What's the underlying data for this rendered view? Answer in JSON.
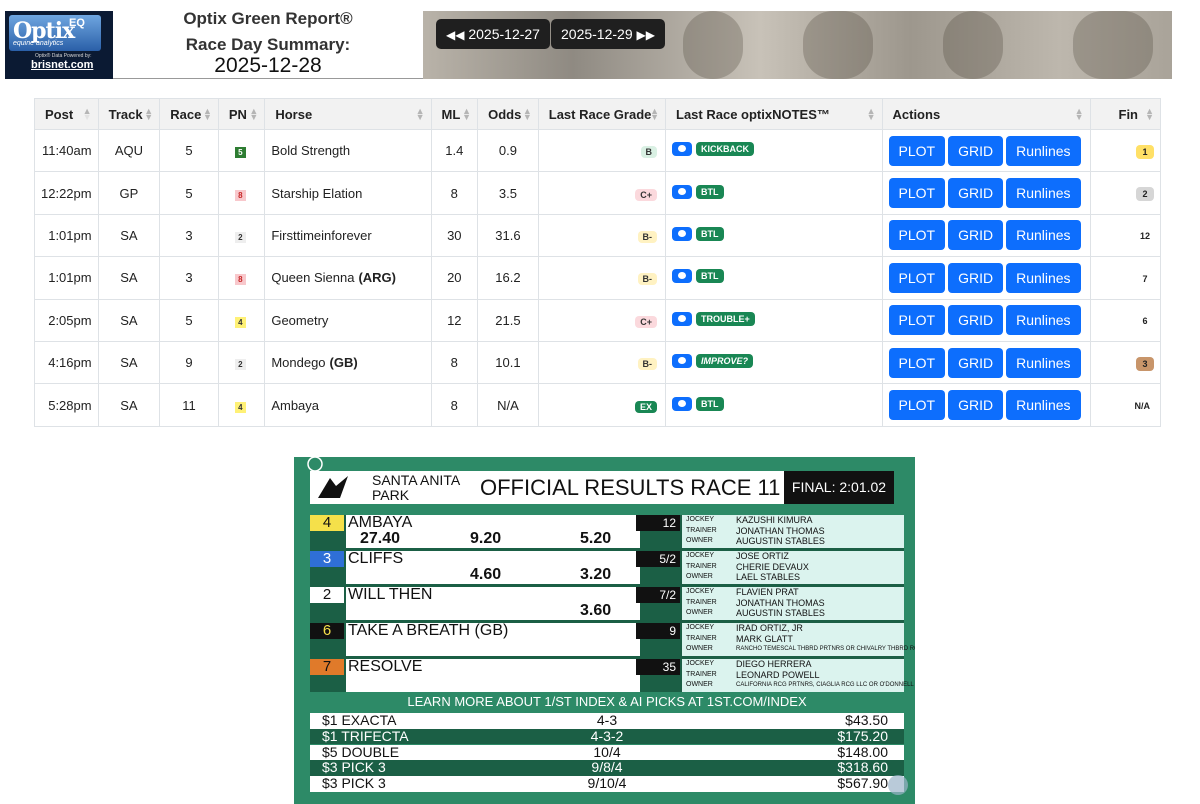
{
  "header": {
    "logo": {
      "brand": "Optix",
      "eq": "EQ",
      "sub": "equine analytics",
      "powered": "Optix® Data Powered by:",
      "partner": "brisnet.com"
    },
    "title_line1": "Optix Green Report®",
    "title_line2": "Race Day Summary:",
    "date": "2025-12-28",
    "prev_date": "2025-12-27",
    "next_date": "2025-12-29",
    "prev_icon": "rewind-icon",
    "next_icon": "fast-forward-icon"
  },
  "table": {
    "columns": [
      "Post",
      "Track",
      "Race",
      "PN",
      "Horse",
      "ML",
      "Odds",
      "Last Race Grade",
      "Last Race optixNOTES™",
      "Actions",
      "Fin"
    ],
    "actions": {
      "plot": "PLOT",
      "grid": "GRID",
      "runlines": "Runlines"
    },
    "rows": [
      {
        "post": "11:40am",
        "track": "AQU",
        "race": "5",
        "pn": "5",
        "pn_bg": "#2e7d32",
        "pn_fg": "#ffffff",
        "horse": "Bold Strength",
        "origin": "",
        "ml": "1.4",
        "odds": "0.9",
        "grade": "B",
        "grade_bg": "#d9f0e3",
        "note": "KICKBACK",
        "note_italic": false,
        "fin": "1",
        "fin_bg": "#ffe066"
      },
      {
        "post": "12:22pm",
        "track": "GP",
        "race": "5",
        "pn": "8",
        "pn_bg": "#f8c8cc",
        "pn_fg": "#c62828",
        "horse": "Starship Elation",
        "origin": "",
        "ml": "8",
        "odds": "3.5",
        "grade": "C+",
        "grade_bg": "#fbd9dd",
        "note": "BTL",
        "note_italic": false,
        "fin": "2",
        "fin_bg": "#d6d6d6"
      },
      {
        "post": "1:01pm",
        "track": "SA",
        "race": "3",
        "pn": "2",
        "pn_bg": "#eeeeee",
        "pn_fg": "#333333",
        "horse": "Firsttimeinforever",
        "origin": "",
        "ml": "30",
        "odds": "31.6",
        "grade": "B-",
        "grade_bg": "#fff2c2",
        "note": "BTL",
        "note_italic": false,
        "fin": "12",
        "fin_bg": "#ffffff"
      },
      {
        "post": "1:01pm",
        "track": "SA",
        "race": "3",
        "pn": "8",
        "pn_bg": "#f8c8cc",
        "pn_fg": "#c62828",
        "horse": "Queen Sienna",
        "origin": "(ARG)",
        "ml": "20",
        "odds": "16.2",
        "grade": "B-",
        "grade_bg": "#fff2c2",
        "note": "BTL",
        "note_italic": false,
        "fin": "7",
        "fin_bg": "#ffffff"
      },
      {
        "post": "2:05pm",
        "track": "SA",
        "race": "5",
        "pn": "4",
        "pn_bg": "#fff176",
        "pn_fg": "#333333",
        "horse": "Geometry",
        "origin": "",
        "ml": "12",
        "odds": "21.5",
        "grade": "C+",
        "grade_bg": "#fbd9dd",
        "note": "TROUBLE+",
        "note_italic": false,
        "fin": "6",
        "fin_bg": "#ffffff"
      },
      {
        "post": "4:16pm",
        "track": "SA",
        "race": "9",
        "pn": "2",
        "pn_bg": "#eeeeee",
        "pn_fg": "#333333",
        "horse": "Mondego",
        "origin": "(GB)",
        "ml": "8",
        "odds": "10.1",
        "grade": "B-",
        "grade_bg": "#fff2c2",
        "note": "IMPROVE?",
        "note_italic": true,
        "fin": "3",
        "fin_bg": "#c8956a"
      },
      {
        "post": "5:28pm",
        "track": "SA",
        "race": "11",
        "pn": "4",
        "pn_bg": "#fff176",
        "pn_fg": "#333333",
        "horse": "Ambaya",
        "origin": "",
        "ml": "8",
        "odds": "N/A",
        "grade": "EX",
        "grade_bg": "#198754",
        "note": "BTL",
        "note_italic": false,
        "fin": "N/A",
        "fin_bg": "#ffffff"
      }
    ]
  },
  "results": {
    "track_name_line1": "SANTA ANITA",
    "track_name_line2": "PARK",
    "title": "OFFICIAL RESULTS RACE 11",
    "final": "FINAL:  2:01.02",
    "labels": {
      "jockey": "JOCKEY",
      "trainer": "TRAINER",
      "owner": "OWNER"
    },
    "entries": [
      {
        "num": "4",
        "num_bg": "#f5e04a",
        "num_fg": "#111111",
        "name": "AMBAYA",
        "win": "27.40",
        "place": "9.20",
        "show": "5.20",
        "odds": "12",
        "jockey": "KAZUSHI KIMURA",
        "trainer": "JONATHAN THOMAS",
        "owner": "AUGUSTIN STABLES",
        "owner_small": false
      },
      {
        "num": "3",
        "num_bg": "#2f6fd6",
        "num_fg": "#ffffff",
        "name": "CLIFFS",
        "win": "",
        "place": "4.60",
        "show": "3.20",
        "odds": "5/2",
        "jockey": "JOSE ORTIZ",
        "trainer": "CHERIE DEVAUX",
        "owner": "LAEL STABLES",
        "owner_small": false
      },
      {
        "num": "2",
        "num_bg": "#ffffff",
        "num_fg": "#111111",
        "name": "WILL THEN",
        "win": "",
        "place": "",
        "show": "3.60",
        "odds": "7/2",
        "jockey": "FLAVIEN PRAT",
        "trainer": "JONATHAN THOMAS",
        "owner": "AUGUSTIN STABLES",
        "owner_small": false
      },
      {
        "num": "6",
        "num_bg": "#111111",
        "num_fg": "#f5e04a",
        "name": "TAKE A BREATH (GB)",
        "win": "",
        "place": "",
        "show": "",
        "odds": "9",
        "jockey": "IRAD ORTIZ, JR",
        "trainer": "MARK GLATT",
        "owner": "RANCHO TEMESCAL THBRD PRTNRS OR CHIVALRY THBRD RCG",
        "owner_small": true
      },
      {
        "num": "7",
        "num_bg": "#e07a2a",
        "num_fg": "#111111",
        "name": "RESOLVE",
        "win": "",
        "place": "",
        "show": "",
        "odds": "35",
        "jockey": "DIEGO HERRERA",
        "trainer": "LEONARD POWELL",
        "owner": "CALIFORNIA RCG PRTNRS, CIAGLIA RCG LLC OR O'DONNELL",
        "owner_small": true
      }
    ],
    "learn_more": "LEARN MORE ABOUT 1/ST INDEX & AI PICKS AT 1ST.COM/INDEX",
    "payouts": [
      {
        "wager": "$1 EXACTA",
        "combo": "4-3",
        "amount": "$43.50"
      },
      {
        "wager": "$1 TRIFECTA",
        "combo": "4-3-2",
        "amount": "$175.20"
      },
      {
        "wager": "$5 DOUBLE",
        "combo": "10/4",
        "amount": "$148.00"
      },
      {
        "wager": "$3 PICK 3",
        "combo": "9/8/4",
        "amount": "$318.60"
      },
      {
        "wager": "$3 PICK 3",
        "combo": "9/10/4",
        "amount": "$567.90"
      }
    ]
  }
}
